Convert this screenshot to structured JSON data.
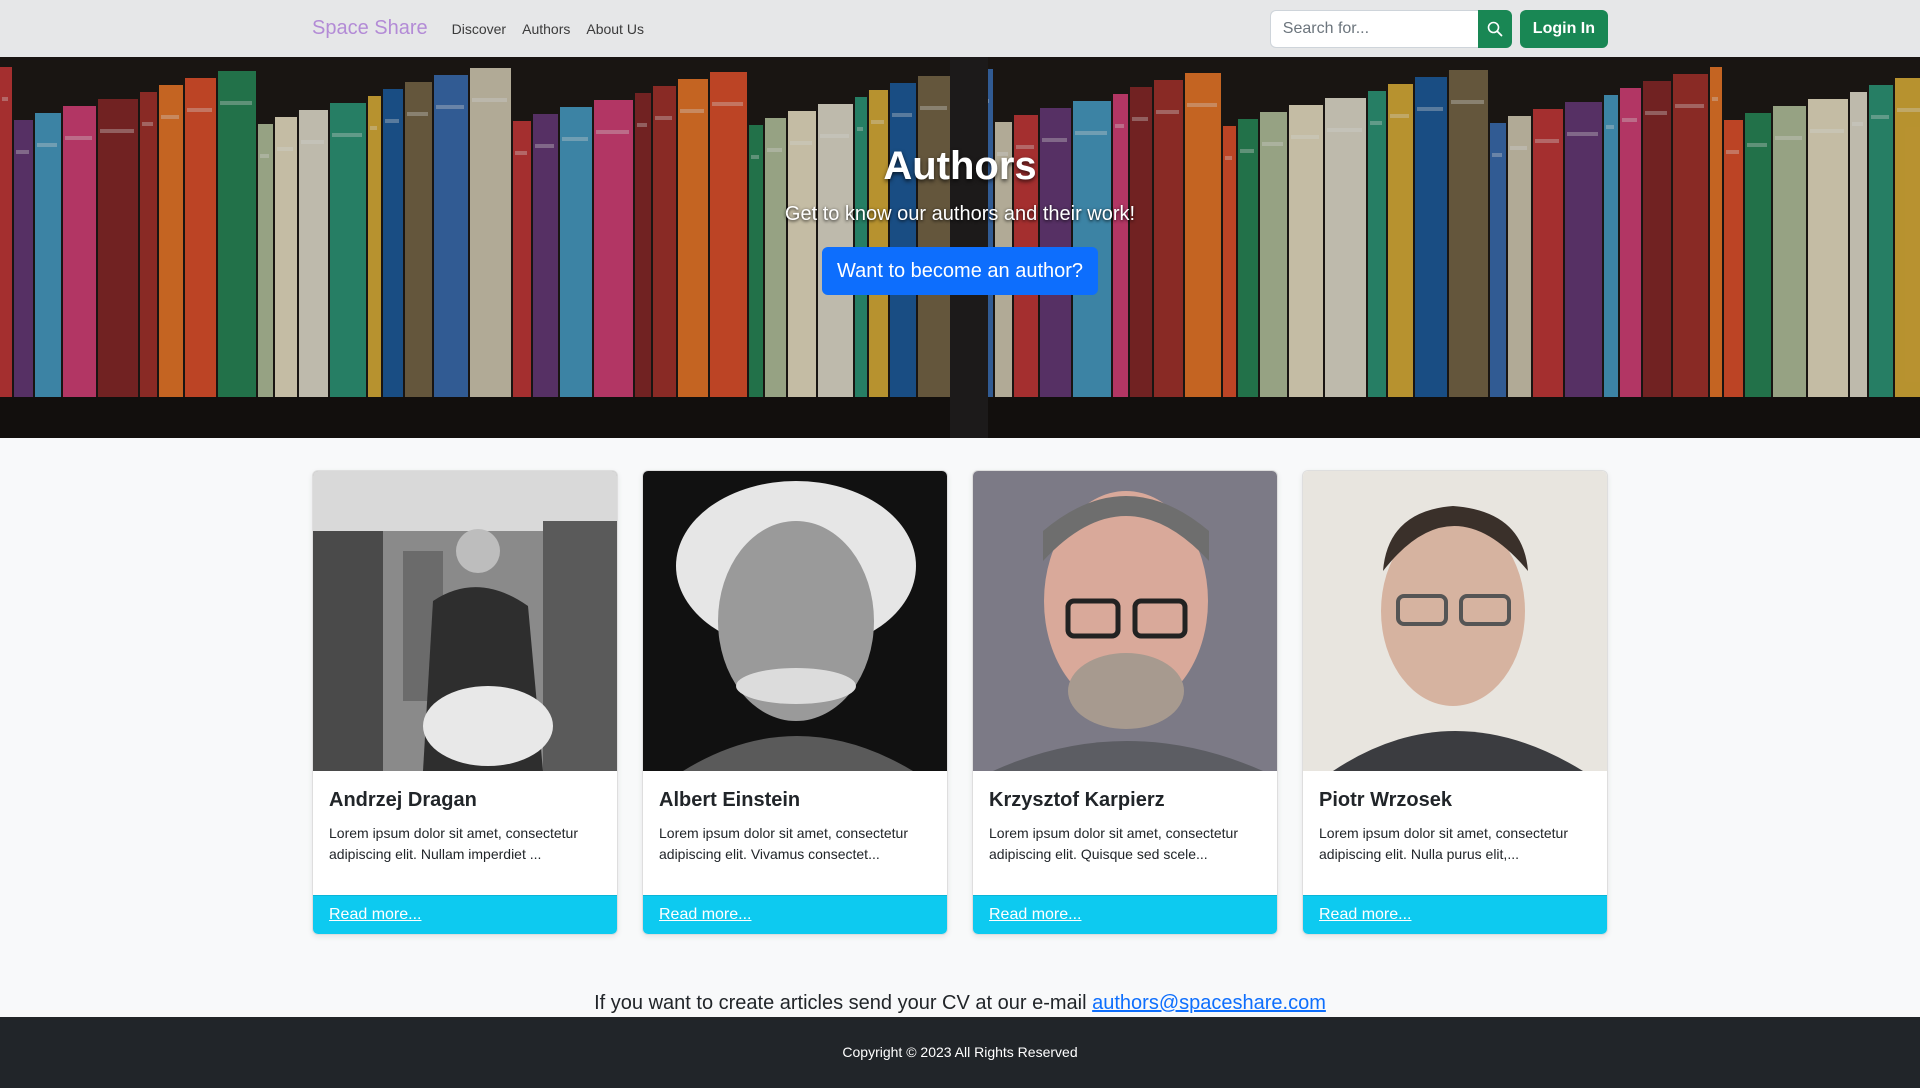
{
  "nav": {
    "brand": "Space Share",
    "links": [
      "Discover",
      "Authors",
      "About Us"
    ],
    "search_placeholder": "Search for...",
    "search_icon": "search-icon",
    "login_label": "Login In"
  },
  "hero": {
    "title": "Authors",
    "subtitle": "Get to know our authors and their work!",
    "button_label": "Want to become an author?"
  },
  "authors": [
    {
      "name": "Andrzej Dragan",
      "bio": "Lorem ipsum dolor sit amet, consectetur adipiscing elit. Nullam imperdiet ...",
      "link": "Read more..."
    },
    {
      "name": "Albert Einstein",
      "bio": "Lorem ipsum dolor sit amet, consectetur adipiscing elit. Vivamus consectet...",
      "link": "Read more..."
    },
    {
      "name": "Krzysztof Karpierz",
      "bio": "Lorem ipsum dolor sit amet, consectetur adipiscing elit. Quisque sed scele...",
      "link": "Read more..."
    },
    {
      "name": "Piotr Wrzosek",
      "bio": "Lorem ipsum dolor sit amet, consectetur adipiscing elit. Nulla purus elit,...",
      "link": "Read more..."
    }
  ],
  "contact": {
    "text": "If you want to create articles send your CV at our e-mail",
    "email": "authors@spaceshare.com"
  },
  "footer": {
    "copyright": "Copyright © 2023 All Rights Reserved"
  },
  "colors": {
    "navbar_bg": "#e6e7e8",
    "brand": "#b38bd6",
    "success": "#198754",
    "primary": "#0d6efd",
    "info": "#0dcaf0",
    "footer_bg": "#212529"
  }
}
